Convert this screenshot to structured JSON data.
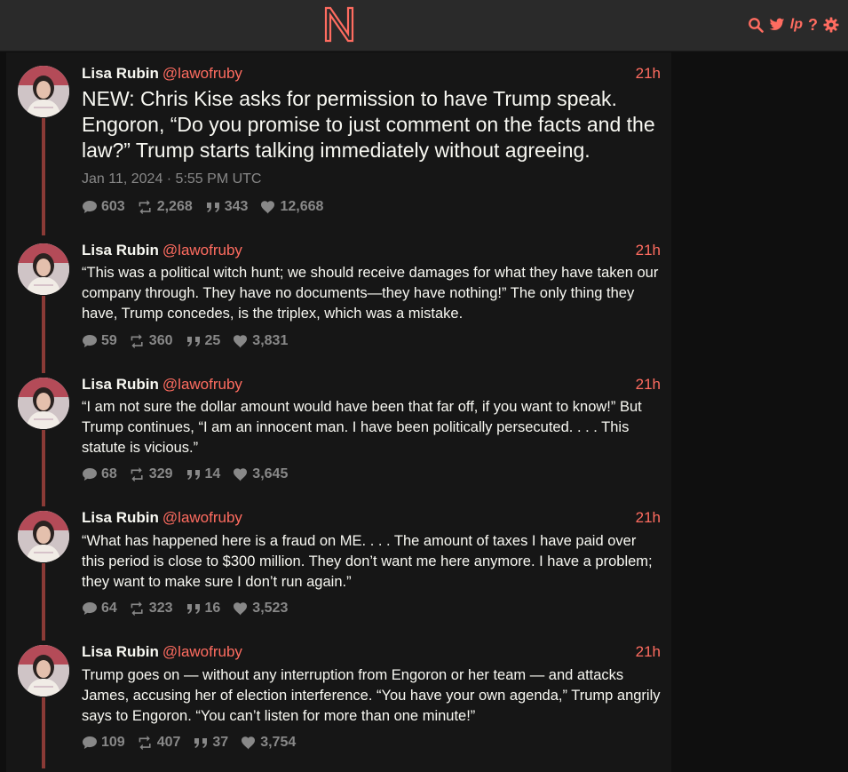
{
  "nav": {
    "logo_letter": "N",
    "icons": [
      "search-icon",
      "twitter-icon",
      "lp-icon",
      "help-icon",
      "gear-icon"
    ],
    "lp_label": "lp",
    "help_label": "?"
  },
  "colors": {
    "accent": "#ff6c60",
    "background": "#0f0f0f",
    "panel": "#161616",
    "navbar": "#2a2a2a",
    "thread_line": "#8a3a36",
    "muted": "#888888"
  },
  "tweets": [
    {
      "fullname": "Lisa Rubin",
      "username": "@lawofruby",
      "date": "21h",
      "text": "NEW: Chris Kise asks for permission to have Trump speak. Engoron, “Do you promise to just comment on the facts and the law?” Trump starts talking immediately without agreeing.",
      "published": "Jan 11, 2024 · 5:55 PM UTC",
      "replies": "603",
      "retweets": "2,268",
      "quotes": "343",
      "likes": "12,668"
    },
    {
      "fullname": "Lisa Rubin",
      "username": "@lawofruby",
      "date": "21h",
      "text": "“This was a political witch hunt; we should receive damages for what they have taken our company through. They have no documents—they have nothing!” The only thing they have, Trump concedes, is the triplex, which was a mistake.",
      "replies": "59",
      "retweets": "360",
      "quotes": "25",
      "likes": "3,831"
    },
    {
      "fullname": "Lisa Rubin",
      "username": "@lawofruby",
      "date": "21h",
      "text": "“I am not sure the dollar amount would have been that far off, if you want to know!” But Trump continues, “I am an innocent man. I have been politically persecuted. . . . This statute is vicious.”",
      "replies": "68",
      "retweets": "329",
      "quotes": "14",
      "likes": "3,645"
    },
    {
      "fullname": "Lisa Rubin",
      "username": "@lawofruby",
      "date": "21h",
      "text": "“What has happened here is a fraud on ME. . . . The amount of taxes I have paid over this period is close to $300 million. They don’t want me here anymore. I have a problem; they want to make sure I don’t run again.”",
      "replies": "64",
      "retweets": "323",
      "quotes": "16",
      "likes": "3,523"
    },
    {
      "fullname": "Lisa Rubin",
      "username": "@lawofruby",
      "date": "21h",
      "text": "Trump goes on — without any interruption from Engoron or her team — and attacks James, accusing her of election interference. “You have your own agenda,” Trump angrily says to Engoron. “You can’t listen for more than one minute!”",
      "replies": "109",
      "retweets": "407",
      "quotes": "37",
      "likes": "3,754"
    }
  ]
}
